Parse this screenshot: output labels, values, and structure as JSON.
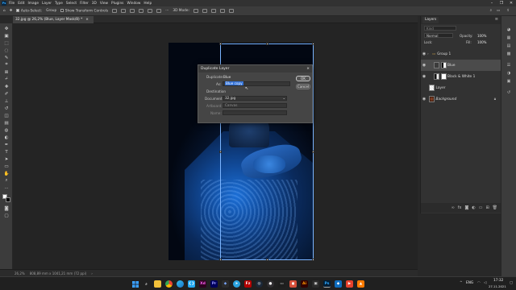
{
  "menubar": {
    "items": [
      "File",
      "Edit",
      "Image",
      "Layer",
      "Type",
      "Select",
      "Filter",
      "3D",
      "View",
      "Plugins",
      "Window",
      "Help"
    ],
    "window_controls": [
      "–",
      "❐",
      "✕"
    ],
    "logo": "Ps"
  },
  "options_bar": {
    "auto_select_label": "Auto-Select:",
    "auto_select_target": "Group",
    "show_transform_label": "Show Transform Controls",
    "mode_3d_label": "3D Mode:"
  },
  "document": {
    "tab_title": "32.jpg @ 26,2% (Blue, Layer Mask/8) *",
    "tab_close": "×"
  },
  "status": {
    "zoom": "26,2%",
    "doc_info": "808,89 mm x 1041,21 mm (72 ppi)"
  },
  "dialog": {
    "title": "Duplicate Layer",
    "close": "×",
    "duplicate_label": "Duplicate:",
    "duplicate_value": "Blue",
    "as_label": "As:",
    "as_value": "Blue copy",
    "destination_label": "Destination",
    "document_label": "Document:",
    "document_value": "32.jpg",
    "artboard_label": "Artboard:",
    "artboard_value": "Canvas",
    "name_label": "Name:",
    "ok_label": "OK",
    "cancel_label": "Cancel"
  },
  "layers_panel": {
    "tabs": [
      "Layers"
    ],
    "kind_placeholder": "Kind",
    "blend_mode": "Normal",
    "opacity_label": "Opacity:",
    "opacity_value": "100%",
    "lock_label": "Lock:",
    "fill_label": "Fill:",
    "fill_value": "100%",
    "layers": [
      {
        "name": "Group 1",
        "type": "group",
        "selected": false
      },
      {
        "name": "Blue",
        "type": "masked",
        "selected": true
      },
      {
        "name": "Black & White 1",
        "type": "adjustment",
        "selected": false
      },
      {
        "name": "Layer",
        "type": "pixel",
        "selected": false
      },
      {
        "name": "Background",
        "type": "background",
        "selected": false
      }
    ],
    "footer_icons": [
      "link-icon",
      "fx-icon",
      "mask-icon",
      "adjustment-icon",
      "folder-icon",
      "new-layer-icon",
      "trash-icon"
    ]
  },
  "taskbar": {
    "language": "ENG",
    "time": "17:32",
    "date": "27.11.2021",
    "apps": [
      "windows",
      "search",
      "file-explorer",
      "chrome",
      "edge",
      "vs-code",
      "adobe-xd",
      "premiere",
      "photoshop-alt",
      "telegram",
      "filezilla",
      "steam",
      "obs",
      "illustrator",
      "photoshop",
      "app-blue",
      "media-player",
      "app-orange"
    ]
  },
  "colors": {
    "accent": "#31a8ff",
    "selection": "#7ab4ff",
    "panel_bg": "#323232",
    "canvas_bg": "#242424"
  }
}
